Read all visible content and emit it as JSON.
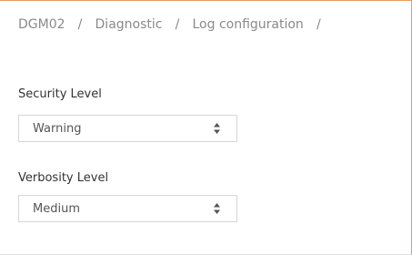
{
  "breadcrumb": {
    "items": [
      "DGM02",
      "Diagnostic",
      "Log configuration"
    ],
    "separator": "/"
  },
  "security_level": {
    "label": "Security Level",
    "value": "Warning"
  },
  "verbosity_level": {
    "label": "Verbosity Level",
    "value": "Medium"
  },
  "colors": {
    "accent_border": "#e89a5a",
    "breadcrumb_text": "#8a8a8a",
    "select_border": "#d6d6d6"
  },
  "icons": {
    "select_arrow": "sort-arrows-icon"
  }
}
